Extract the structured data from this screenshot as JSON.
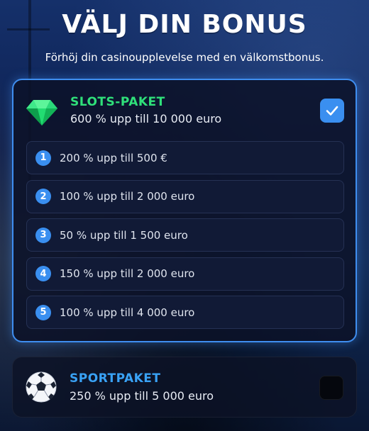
{
  "header": {
    "title": "VÄLJ DIN BONUS",
    "subtitle": "Förhöj din casinoupplevelse med en välkomstbonus."
  },
  "packages": [
    {
      "name": "SLOTS-PAKET",
      "description": "600 % upp till 10 000 euro",
      "icon": "emerald-gem-icon",
      "selected": true,
      "accent": "#2fe07a",
      "tiers": [
        {
          "number": "1",
          "text": "200 % upp till 500 €"
        },
        {
          "number": "2",
          "text": "100 % upp till 2 000 euro"
        },
        {
          "number": "3",
          "text": "50 % upp till 1 500 euro"
        },
        {
          "number": "4",
          "text": "150 % upp till 2 000 euro"
        },
        {
          "number": "5",
          "text": "100 % upp till 4 000 euro"
        }
      ]
    },
    {
      "name": "SPORTPAKET",
      "description": "250 % upp till 5 000 euro",
      "icon": "soccer-ball-icon",
      "selected": false,
      "accent": "#39a2f5"
    }
  ],
  "colors": {
    "selected_border": "#3f8ef0",
    "checkbox_on": "#3a8ff0",
    "tier_badge": "#3a8ff0"
  }
}
